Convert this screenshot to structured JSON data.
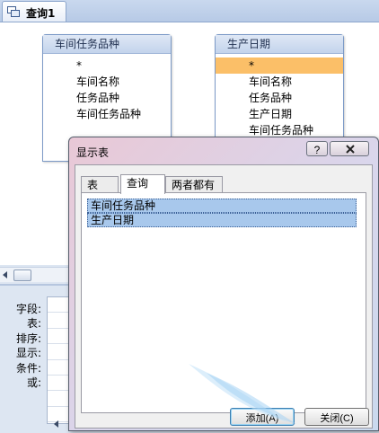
{
  "tab": {
    "title": "查询1"
  },
  "tables": [
    {
      "title": "车间任务品种",
      "fields": [
        "*",
        "车间名称",
        "任务品种",
        "车间任务品种"
      ]
    },
    {
      "title": "生产日期",
      "fields": [
        "*",
        "车间名称",
        "任务品种",
        "生产日期",
        "车间任务品种"
      ]
    }
  ],
  "grid": {
    "row_labels": [
      "字段:",
      "表:",
      "排序:",
      "显示:",
      "条件:",
      "或:"
    ]
  },
  "dialog": {
    "title": "显示表",
    "help": "?",
    "tabs": [
      "表",
      "查询",
      "两者都有"
    ],
    "active_tab": "查询",
    "items": [
      "车间任务品种",
      "生产日期"
    ],
    "add_button": "添加(A)",
    "close_button": "关闭(C)"
  },
  "colors": {
    "selected_field": "#fbbf68",
    "list_selection": "#a8c8ec"
  }
}
